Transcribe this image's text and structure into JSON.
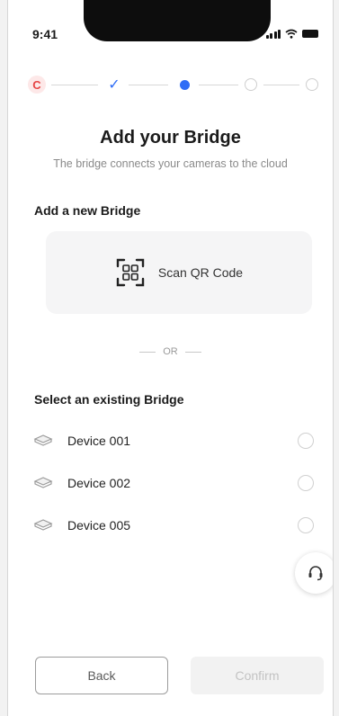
{
  "status_bar": {
    "time": "9:41"
  },
  "stepper": {
    "reset_glyph": "C",
    "done_glyph": "✓",
    "steps": [
      "reset",
      "done",
      "current",
      "todo",
      "todo"
    ]
  },
  "header": {
    "title": "Add your Bridge",
    "subtitle": "The bridge connects your cameras to the cloud"
  },
  "add_section": {
    "heading": "Add a new Bridge",
    "scan_label": "Scan QR Code",
    "scan_icon": "qr-scan-icon"
  },
  "divider": {
    "label": "OR"
  },
  "existing_section": {
    "heading": "Select an existing Bridge",
    "devices": [
      {
        "label": "Device 001",
        "icon": "bridge-device-icon",
        "selected": false
      },
      {
        "label": "Device 002",
        "icon": "bridge-device-icon",
        "selected": false
      },
      {
        "label": "Device 005",
        "icon": "bridge-device-icon",
        "selected": false
      }
    ]
  },
  "support": {
    "icon": "headset-icon"
  },
  "footer": {
    "back_label": "Back",
    "confirm_label": "Confirm",
    "confirm_enabled": false
  },
  "colors": {
    "accent": "#2f6df6",
    "reset": "#e64545",
    "disabled_text": "#c3c3c3"
  }
}
